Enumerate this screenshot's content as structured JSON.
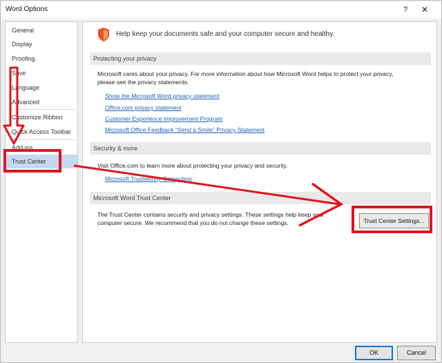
{
  "window": {
    "title": "Word Options",
    "help_label": "?",
    "close_label": "✕"
  },
  "sidebar": {
    "items": [
      {
        "label": "General"
      },
      {
        "label": "Display"
      },
      {
        "label": "Proofing"
      },
      {
        "label": "Save"
      },
      {
        "label": "Language"
      },
      {
        "label": "Advanced"
      },
      {
        "label": "Customize Ribbon"
      },
      {
        "label": "Quick Access Toolbar"
      },
      {
        "label": "Add-ins"
      },
      {
        "label": "Trust Center"
      }
    ],
    "selected": "Trust Center"
  },
  "main": {
    "headline": "Help keep your documents safe and your computer secure and healthy.",
    "privacy": {
      "header": "Protecting your privacy",
      "text_line1": "Microsoft cares about your privacy. For more information about how Microsoft Word helps to protect your privacy,",
      "text_line2": "please see the privacy statements.",
      "links": [
        "Show the Microsoft Word privacy statement",
        "Office.com privacy statement",
        "Customer Experience Improvement Program",
        "Microsoft Office Feedback “Send a Smile” Privacy Statement"
      ]
    },
    "security": {
      "header": "Security & more",
      "text": "Visit Office.com to learn more about protecting your privacy and security.",
      "link": "Microsoft Trustworthy Computing"
    },
    "trust_center": {
      "header": "Microsoft Word Trust Center",
      "text_line1": "The Trust Center contains security and privacy settings. These settings help keep your",
      "text_line2": "computer secure. We recommend that you do not change these settings.",
      "button_label": "Trust Center Settings..."
    }
  },
  "footer": {
    "ok_label": "OK",
    "cancel_label": "Cancel"
  },
  "colors": {
    "annotation": "#e0141e",
    "link": "#1f5fb4",
    "selection": "#c5d9f1",
    "shield": "#e8571c"
  }
}
